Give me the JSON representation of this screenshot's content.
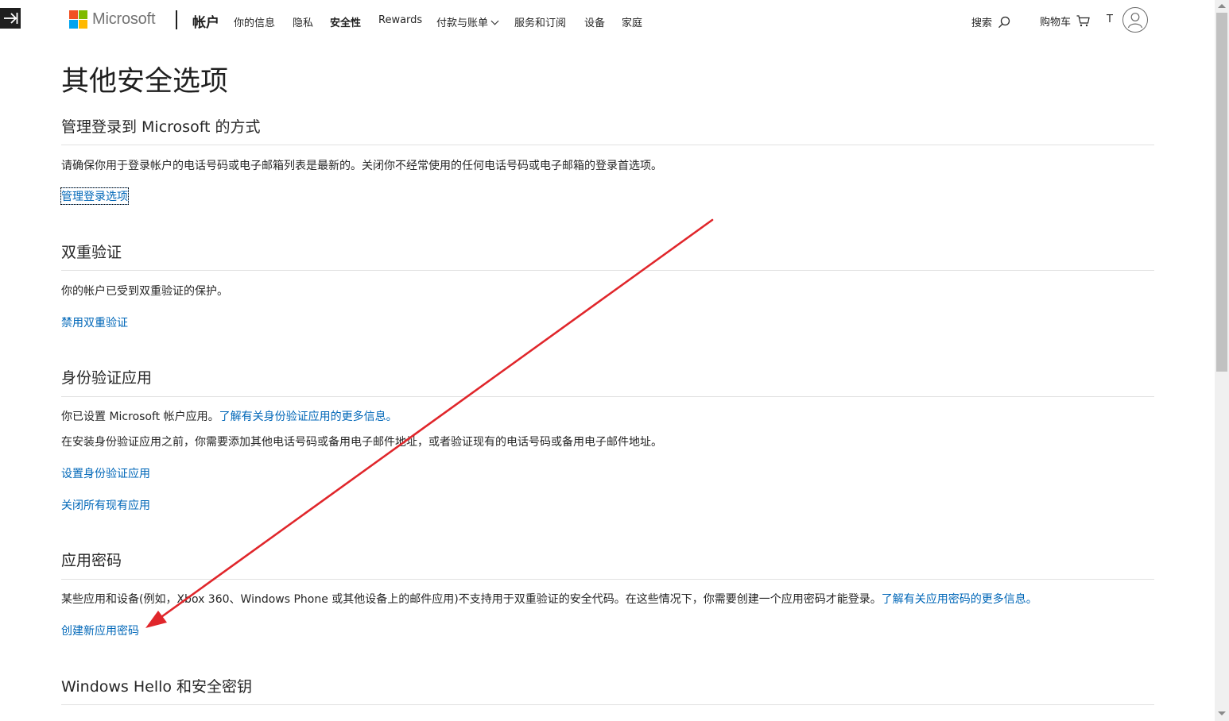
{
  "header": {
    "logo_text": "Microsoft",
    "logo_colors": [
      "#f25022",
      "#7fba00",
      "#00a4ef",
      "#ffb900"
    ],
    "brand": "帐户",
    "nav": [
      {
        "label": "你的信息"
      },
      {
        "label": "隐私"
      },
      {
        "label": "安全性",
        "active": true
      },
      {
        "label": "Rewards"
      },
      {
        "label": "付款与账单",
        "dropdown": true
      },
      {
        "label": "服务和订阅"
      },
      {
        "label": "设备"
      },
      {
        "label": "家庭"
      }
    ],
    "search_label": "搜索",
    "cart_label": "购物车",
    "user_initial": "T"
  },
  "page": {
    "title": "其他安全选项"
  },
  "sections": {
    "signin": {
      "title": "管理登录到 Microsoft 的方式",
      "desc": "请确保你用于登录帐户的电话号码或电子邮箱列表是最新的。关闭你不经常使用的任何电话号码或电子邮箱的登录首选项。",
      "link": "管理登录选项"
    },
    "twostep": {
      "title": "双重验证",
      "desc": "你的帐户已受到双重验证的保护。",
      "link": "禁用双重验证"
    },
    "authapp": {
      "title": "身份验证应用",
      "desc1": "你已设置 Microsoft 帐户应用。",
      "desc1_link": "了解有关身份验证应用的更多信息。",
      "desc2": "在安装身份验证应用之前，你需要添加其他电话号码或备用电子邮件地址，或者验证现有的电话号码或备用电子邮件地址。",
      "link1": "设置身份验证应用",
      "link2": "关闭所有现有应用"
    },
    "apppw": {
      "title": "应用密码",
      "desc": "某些应用和设备(例如，Xbox 360、Windows Phone 或其他设备上的邮件应用)不支持用于双重验证的安全代码。在这些情况下，你需要创建一个应用密码才能登录。",
      "desc_link": "了解有关应用密码的更多信息。",
      "link": "创建新应用密码"
    },
    "hello": {
      "title": "Windows Hello 和安全密钥"
    }
  },
  "colors": {
    "link": "#0067b8",
    "annotation_arrow": "#e0262b"
  }
}
